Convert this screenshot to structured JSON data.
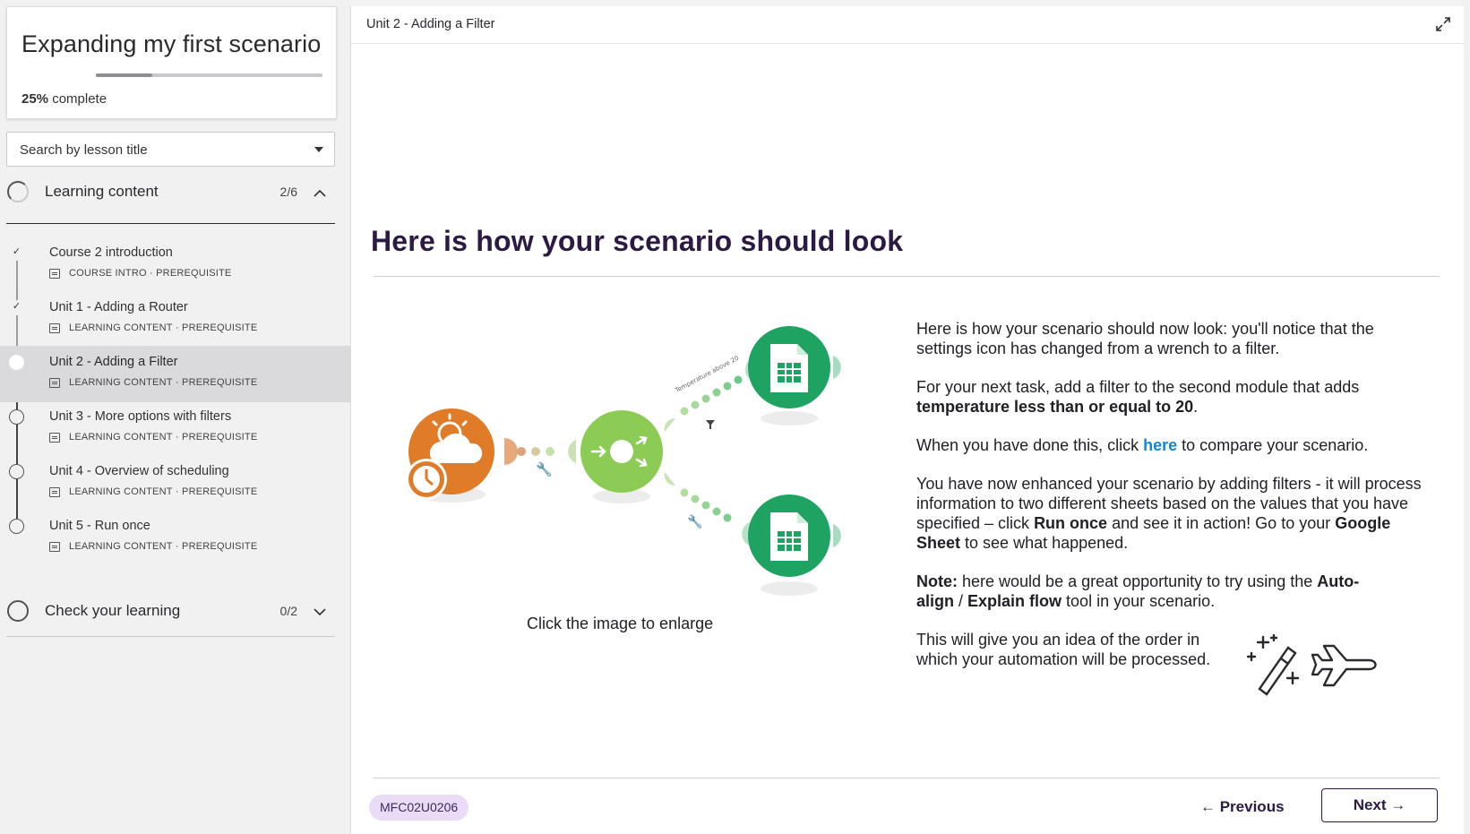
{
  "course": {
    "title": "Expanding my first scenario",
    "progress_pct": 25,
    "progress_value": "25%",
    "progress_suffix": "complete"
  },
  "search": {
    "placeholder": "Search by lesson title"
  },
  "sections": [
    {
      "label": "Learning content",
      "count": "2/6",
      "expanded": true,
      "lessons": [
        {
          "title": "Course 2 introduction",
          "type": "COURSE INTRO",
          "tag": "PREREQUISITE",
          "status": "done"
        },
        {
          "title": "Unit 1 - Adding a Router",
          "type": "LEARNING CONTENT",
          "tag": "PREREQUISITE",
          "status": "done"
        },
        {
          "title": "Unit 2 - Adding a Filter",
          "type": "LEARNING CONTENT",
          "tag": "PREREQUISITE",
          "status": "current"
        },
        {
          "title": "Unit 3 - More options with filters",
          "type": "LEARNING CONTENT",
          "tag": "PREREQUISITE",
          "status": "todo"
        },
        {
          "title": "Unit 4 - Overview of scheduling",
          "type": "LEARNING CONTENT",
          "tag": "PREREQUISITE",
          "status": "todo"
        },
        {
          "title": "Unit 5 - Run once",
          "type": "LEARNING CONTENT",
          "tag": "PREREQUISITE",
          "status": "todo"
        }
      ]
    },
    {
      "label": "Check your learning",
      "count": "0/2",
      "expanded": false
    }
  ],
  "main": {
    "breadcrumb": "Unit 2 - Adding a Filter",
    "heading": "Here is how your scenario should look",
    "diagram_caption": "Click the image to enlarge",
    "diagram_filter_label": "Temperature above 20",
    "p1": "Here is how your scenario should now look: you'll notice that the settings icon has changed from a wrench to a filter.",
    "p2_a": "For your next task, add a filter to the second module that adds ",
    "p2_b": "temperature less than or equal to 20",
    "p2_c": ".",
    "p3_a": "When you have done this, click ",
    "p3_link": "here",
    "p3_b": " to compare your scenario.",
    "p4_a": "You have now enhanced your scenario by adding filters - it will process information to two different sheets based on the values that you have specified – click ",
    "p4_b": "Run once",
    "p4_c": " and see it in action! Go to your ",
    "p4_d": "Google Sheet",
    "p4_e": " to see what happened.",
    "p5_a": "Note:",
    "p5_b": " here would be a great opportunity to try using the ",
    "p5_c": "Auto-align",
    "p5_d": " / ",
    "p5_e": "Explain flow",
    "p5_f": " tool in your scenario.",
    "p6": "This will give you an idea of the order in which your automation will be processed.",
    "lesson_code": "MFC02U0206",
    "prev_label": "← Previous",
    "next_label": "Next →"
  },
  "icons": {
    "expand": "expand-icon",
    "chevron_up": "chevron-up-icon",
    "chevron_down": "chevron-down-icon"
  },
  "colors": {
    "heading": "#2b1b44",
    "link": "#1187d6",
    "weather_module": "#e07b27",
    "router_module": "#8ccc56",
    "sheets_module": "#1ea362",
    "code_pill_bg": "#eadcf7"
  }
}
